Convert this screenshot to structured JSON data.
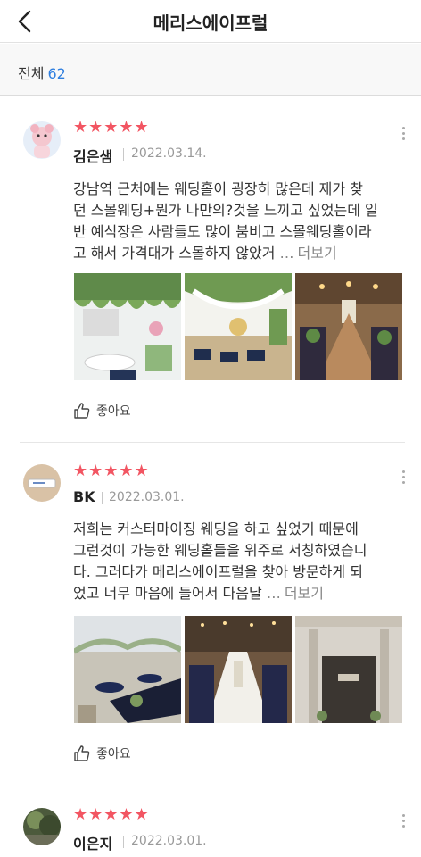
{
  "header": {
    "title": "메리스에이프럴"
  },
  "summary": {
    "label": "전체",
    "count": "62"
  },
  "colors": {
    "star": "#f25562",
    "accent": "#2f7fe0"
  },
  "reviews": [
    {
      "stars": "★★★★★",
      "name": "김은샘",
      "date": "2022.03.14.",
      "lines": [
        "강남역 근처에는 웨딩홀이 굉장히 많은데 제가 찾",
        "던 스몰웨딩+뭔가 나만의?것을 느끼고 싶었는데 일",
        "반 예식장은 사람들도 많이 붐비고 스몰웨딩홀이라",
        "고 해서 가격대가 스몰하지 않았거"
      ],
      "ellipsis": "…",
      "read_more": "더보기",
      "like": "좋아요",
      "icons": [
        "more-vertical-icon",
        "thumbs-up-icon"
      ]
    },
    {
      "stars": "★★★★★",
      "name": "BK",
      "date": "2022.03.01.",
      "lines": [
        "저희는 커스터마이징 웨딩을 하고 싶었기 때문에",
        "그런것이 가능한 웨딩홀들을 위주로 서칭하였습니",
        "다. 그러다가 메리스에이프럴을 찾아 방문하게 되",
        "었고 너무 마음에 들어서 다음날"
      ],
      "ellipsis": "…",
      "read_more": "더보기",
      "like": "좋아요"
    },
    {
      "stars": "★★★★★",
      "name": "이은지",
      "date": "2022.03.01."
    }
  ]
}
